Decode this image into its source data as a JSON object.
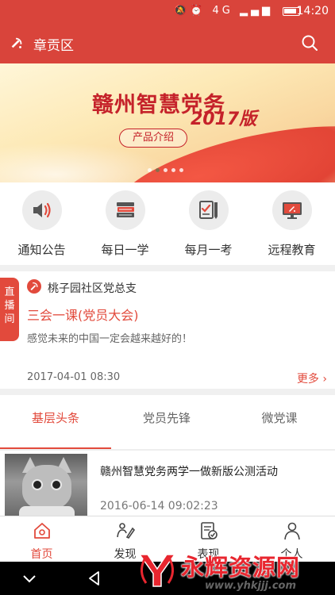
{
  "status_bar": {
    "icons": [
      "mute-icon",
      "alarm-icon",
      "wifi-icon",
      "signal-icon",
      "battery-icon"
    ],
    "network": "4G",
    "time": "14:20"
  },
  "app_bar": {
    "title": "章贡区",
    "icon": "party-emblem-icon",
    "search_icon": "search-icon",
    "color": "#d9443b"
  },
  "banner": {
    "title": "赣州智慧党务",
    "year": "2017版",
    "button": "产品介绍",
    "slide_count": 5,
    "active_slide": 1
  },
  "quick_menu": [
    {
      "label": "通知公告",
      "icon": "speaker-icon"
    },
    {
      "label": "每日一学",
      "icon": "books-icon"
    },
    {
      "label": "每月一考",
      "icon": "exam-icon"
    },
    {
      "label": "远程教育",
      "icon": "monitor-icon"
    }
  ],
  "live_card": {
    "tag": "直播间",
    "org": "桃子园社区党总支",
    "meeting": "三会一课(党员大会)",
    "desc": "感觉未来的中国一定会越来越好的！",
    "date": "2017-04-01 08:30",
    "more": "更多"
  },
  "tabs": [
    {
      "label": "基层头条",
      "active": true
    },
    {
      "label": "党员先锋",
      "active": false
    },
    {
      "label": "微党课",
      "active": false
    }
  ],
  "news": [
    {
      "title": "赣州智慧党务两学一做新版公测活动",
      "time": "2016-06-14 09:02:23",
      "thumb": "cat-photo"
    }
  ],
  "bottom_nav": [
    {
      "label": "首页",
      "icon": "home-icon",
      "active": true
    },
    {
      "label": "发现",
      "icon": "discover-icon",
      "active": false
    },
    {
      "label": "表现",
      "icon": "performance-icon",
      "active": false
    },
    {
      "label": "个人",
      "icon": "person-icon",
      "active": false
    }
  ],
  "watermark": {
    "text": "永辉资源网",
    "url": "www.yhkjjj.com"
  },
  "accent_color": "#e24a3c"
}
